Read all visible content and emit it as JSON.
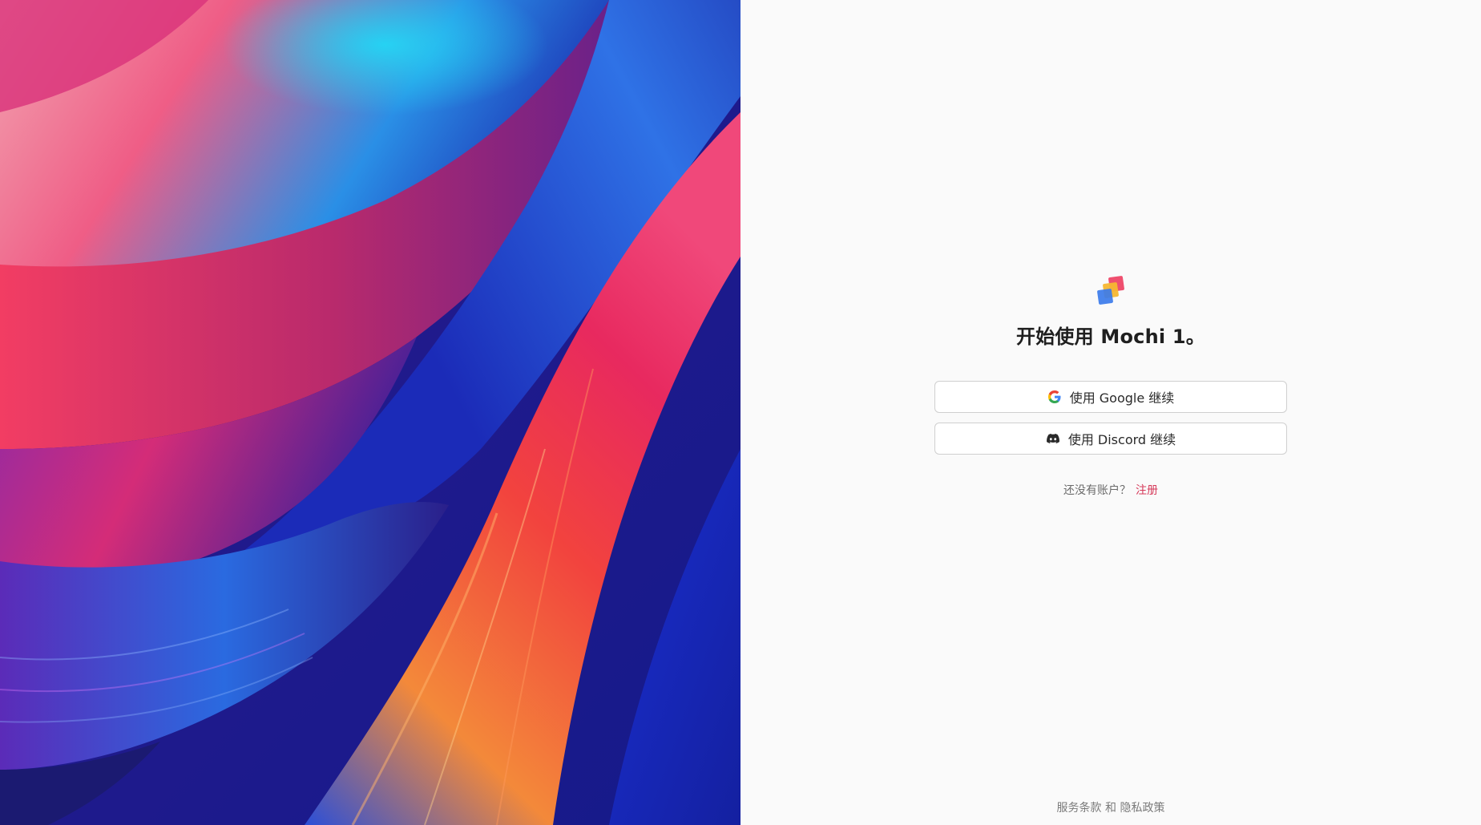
{
  "art": {
    "colors": {
      "deep_blue": "#1a1fa8",
      "bright_blue": "#1e5bdc",
      "cyan": "#1ec6ee",
      "magenta": "#e2246a",
      "red": "#f2304f",
      "orange": "#f46a2a",
      "purple": "#7a2aa0",
      "pink": "#f39aa8"
    }
  },
  "auth": {
    "logo_icon": "mochi-logo-icon",
    "title": "开始使用 Mochi 1。",
    "google_button": {
      "icon": "google-icon",
      "label": "使用 Google 继续"
    },
    "discord_button": {
      "icon": "discord-icon",
      "label": "使用 Discord 继续"
    },
    "signup": {
      "prompt": "还没有账户？",
      "link": "注册"
    },
    "footer": {
      "terms": "服务条款",
      "and": "和",
      "privacy": "隐私政策"
    }
  },
  "colors": {
    "accent_link": "#d63a5a",
    "page_bg": "#fafafa"
  }
}
